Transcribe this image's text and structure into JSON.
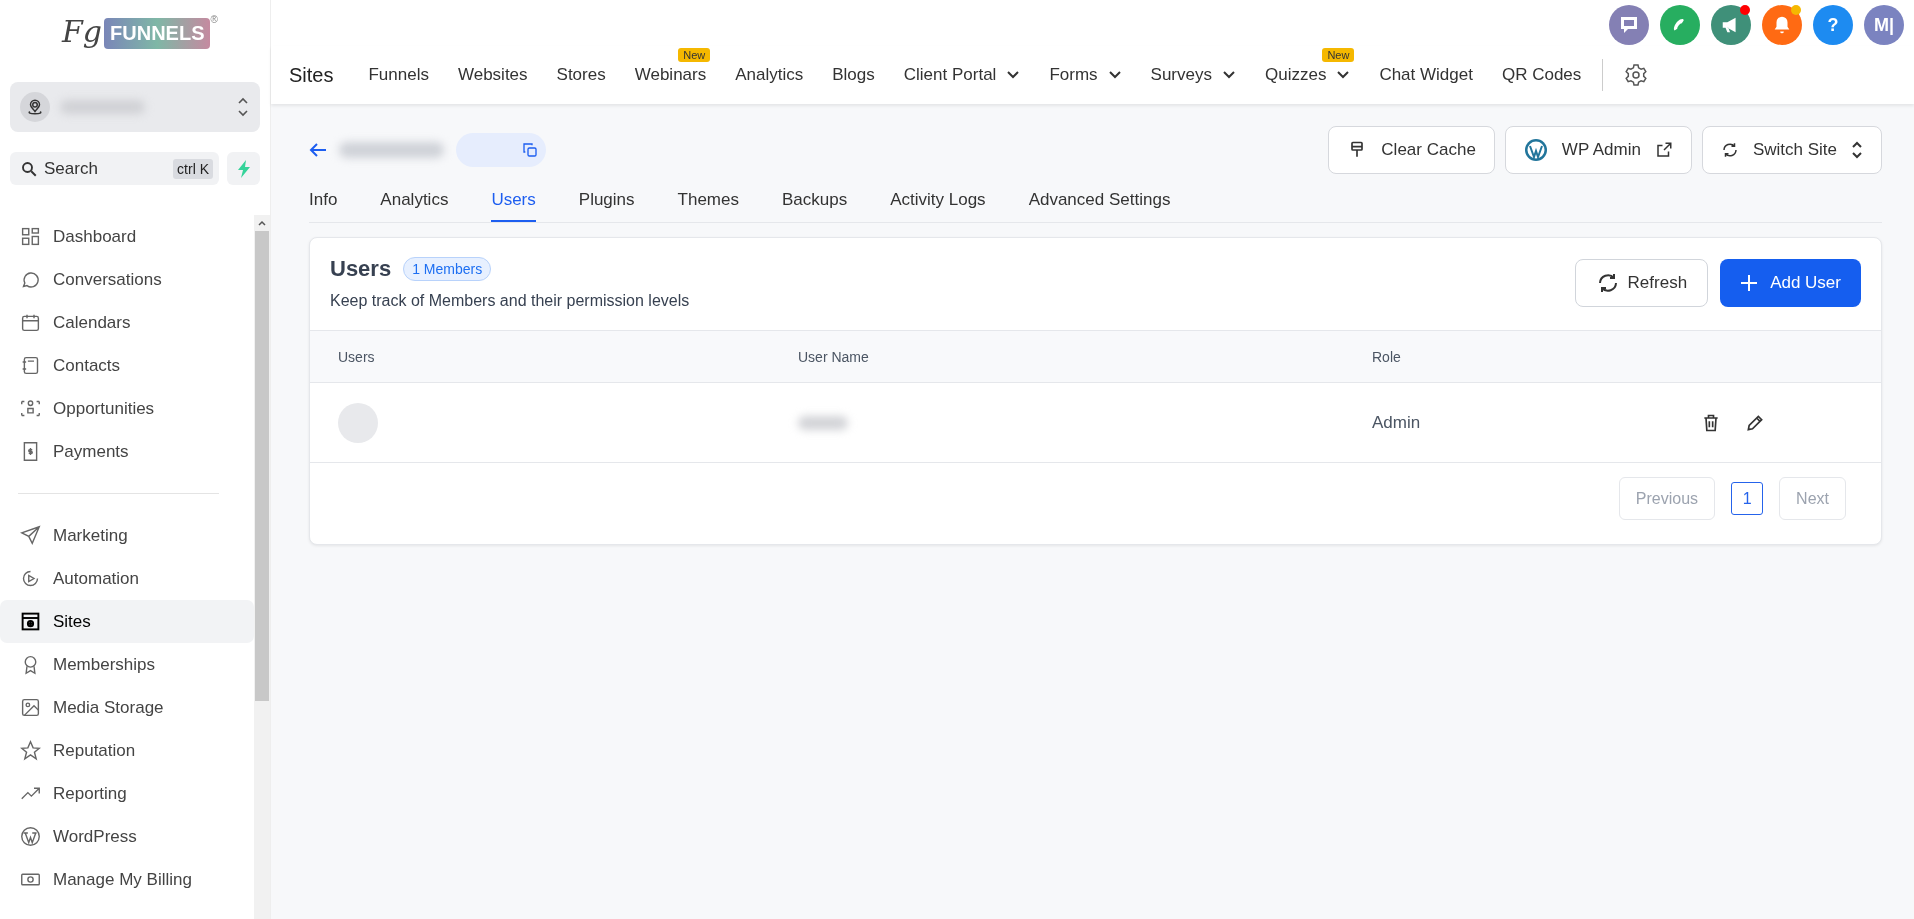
{
  "logo": {
    "script": "Fg",
    "word": "FUNNELS",
    "mark": "®"
  },
  "header_icons": [
    {
      "kind": "chat",
      "color": "#8480b4",
      "unread": false
    },
    {
      "kind": "phone",
      "color": "#27ae60",
      "unread": false
    },
    {
      "kind": "megaphone",
      "color": "#3f9079",
      "unread": true
    },
    {
      "kind": "bell",
      "color": "#ff6a13",
      "unread": true
    },
    {
      "kind": "help",
      "color": "#1d8bf1",
      "unread": false,
      "text": "?"
    },
    {
      "kind": "avatar",
      "color": "#7b83c0",
      "unread": false,
      "text": "M|"
    }
  ],
  "account_switcher": {
    "expanded": false
  },
  "search": {
    "placeholder": "Search",
    "shortcut": "ctrl K"
  },
  "sidebar": {
    "main": [
      {
        "label": "Dashboard",
        "selected": false
      },
      {
        "label": "Conversations",
        "selected": false
      },
      {
        "label": "Calendars",
        "selected": false
      },
      {
        "label": "Contacts",
        "selected": false
      },
      {
        "label": "Opportunities",
        "selected": false
      },
      {
        "label": "Payments",
        "selected": false
      }
    ],
    "tools": [
      {
        "label": "Marketing",
        "selected": false
      },
      {
        "label": "Automation",
        "selected": false
      },
      {
        "label": "Sites",
        "selected": true
      },
      {
        "label": "Memberships",
        "selected": false
      },
      {
        "label": "Media Storage",
        "selected": false
      },
      {
        "label": "Reputation",
        "selected": false
      },
      {
        "label": "Reporting",
        "selected": false
      },
      {
        "label": "WordPress",
        "selected": false
      },
      {
        "label": "Manage My Billing",
        "selected": false
      }
    ]
  },
  "topnav": {
    "title": "Sites",
    "items": [
      {
        "label": "Funnels",
        "dropdown": false
      },
      {
        "label": "Websites",
        "dropdown": false
      },
      {
        "label": "Stores",
        "dropdown": false
      },
      {
        "label": "Webinars",
        "dropdown": false,
        "badge": "New"
      },
      {
        "label": "Analytics",
        "dropdown": false
      },
      {
        "label": "Blogs",
        "dropdown": false
      },
      {
        "label": "Client Portal",
        "dropdown": true
      },
      {
        "label": "Forms",
        "dropdown": true
      },
      {
        "label": "Surveys",
        "dropdown": true
      },
      {
        "label": "Quizzes",
        "dropdown": true,
        "badge": "New"
      },
      {
        "label": "Chat Widget",
        "dropdown": false
      },
      {
        "label": "QR Codes",
        "dropdown": false
      }
    ]
  },
  "actions": [
    {
      "label": "Clear Cache",
      "kind": "cache"
    },
    {
      "label": "WP Admin",
      "kind": "external"
    },
    {
      "label": "Switch Site",
      "kind": "switch"
    }
  ],
  "tabs": [
    {
      "label": "Info",
      "selected": false
    },
    {
      "label": "Analytics",
      "selected": false
    },
    {
      "label": "Users",
      "selected": true
    },
    {
      "label": "Plugins",
      "selected": false
    },
    {
      "label": "Themes",
      "selected": false
    },
    {
      "label": "Backups",
      "selected": false
    },
    {
      "label": "Activity Logs",
      "selected": false
    },
    {
      "label": "Advanced Settings",
      "selected": false
    }
  ],
  "card": {
    "title": "Users",
    "count_badge": "1 Members",
    "subtitle": "Keep track of Members and their permission levels",
    "refresh": "Refresh",
    "add": "Add User"
  },
  "table": {
    "columns": [
      "Users",
      "User Name",
      "Role"
    ],
    "rows": [
      {
        "role": "Admin"
      }
    ]
  },
  "pagination": {
    "previous": {
      "label": "Previous",
      "disabled": true
    },
    "pages": [
      {
        "label": "1",
        "selected": true
      }
    ],
    "next": {
      "label": "Next",
      "disabled": true
    }
  }
}
